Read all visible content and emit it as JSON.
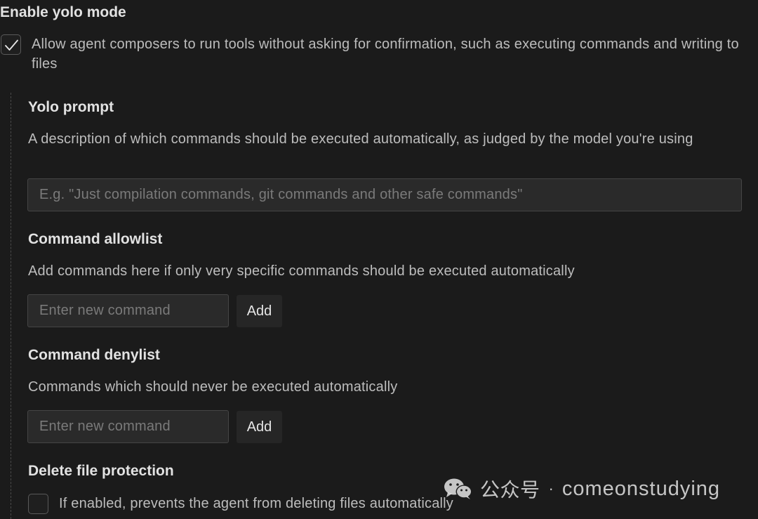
{
  "yolo": {
    "title": "Enable yolo mode",
    "checked": true,
    "description": "Allow agent composers to run tools without asking for confirmation, such as executing commands and writing to files"
  },
  "yolo_prompt": {
    "title": "Yolo prompt",
    "description": "A description of which commands should be executed automatically, as judged by the model you're using",
    "input_value": "",
    "placeholder": "E.g. \"Just compilation commands, git commands and other safe commands\""
  },
  "allowlist": {
    "title": "Command allowlist",
    "description": "Add commands here if only very specific commands should be executed automatically",
    "input_value": "",
    "placeholder": "Enter new command",
    "add_label": "Add"
  },
  "denylist": {
    "title": "Command denylist",
    "description": "Commands which should never be executed automatically",
    "input_value": "",
    "placeholder": "Enter new command",
    "add_label": "Add"
  },
  "delete_protection": {
    "title": "Delete file protection",
    "checked": false,
    "description": "If enabled, prevents the agent from deleting files automatically"
  },
  "watermark": {
    "icon": "wechat-icon",
    "label": "公众号",
    "separator": "·",
    "account": "comeonstudying"
  }
}
